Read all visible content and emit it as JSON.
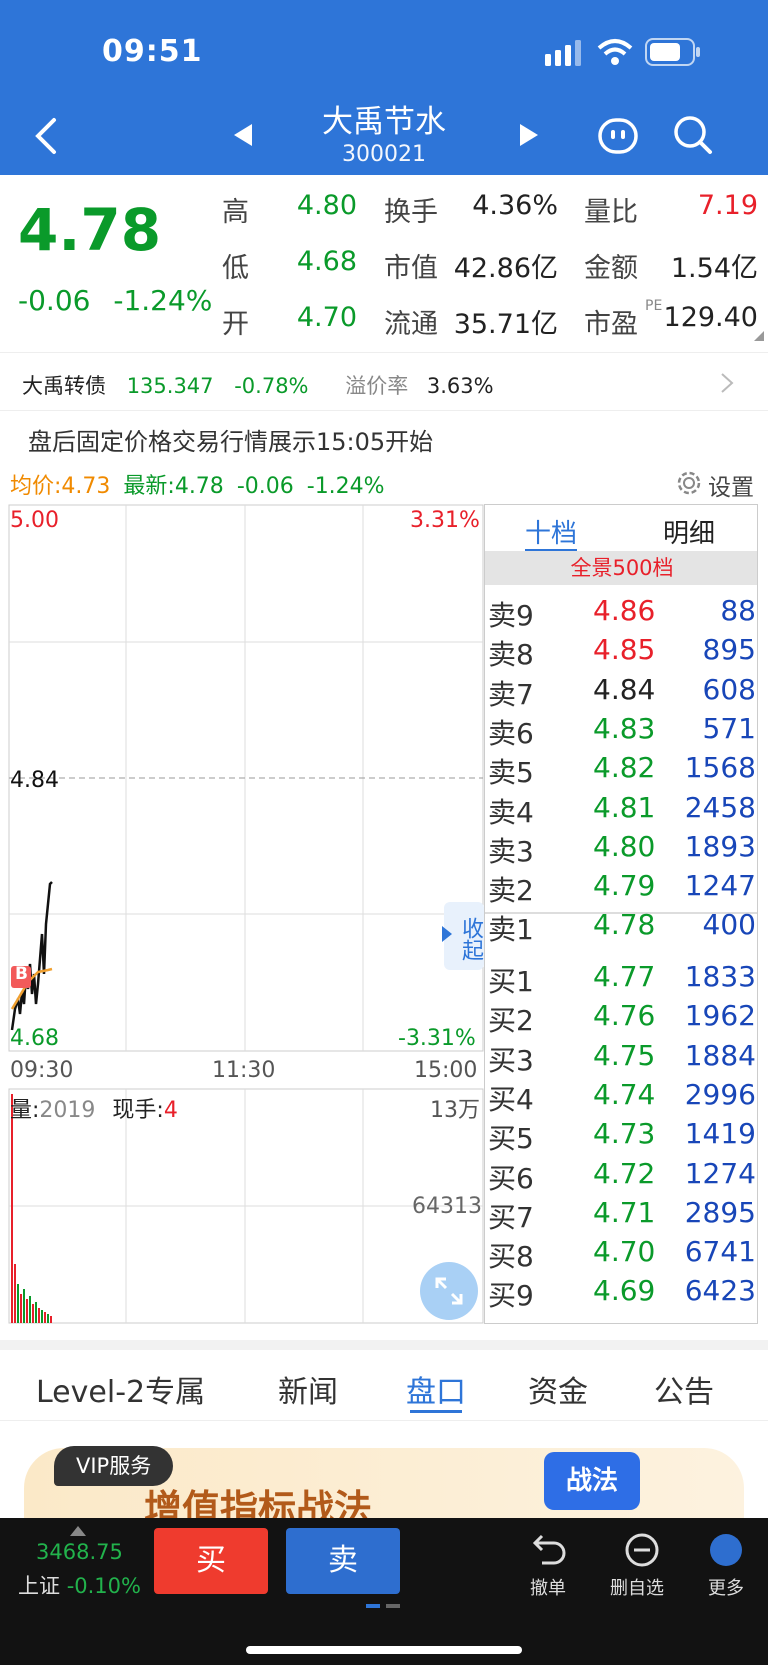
{
  "status_bar": {
    "time": "09:51"
  },
  "header": {
    "title": "大禹节水",
    "code": "300021"
  },
  "quote": {
    "price": "4.78",
    "change": "-0.06",
    "change_pct": "-1.24%",
    "fields": [
      {
        "label": "高",
        "value": "4.80",
        "color": "green"
      },
      {
        "label": "换手",
        "value": "4.36%",
        "color": "dark"
      },
      {
        "label": "量比",
        "value": "7.19",
        "color": "red"
      },
      {
        "label": "低",
        "value": "4.68",
        "color": "green"
      },
      {
        "label": "市值",
        "value": "42.86亿",
        "color": "dark"
      },
      {
        "label": "金额",
        "value": "1.54亿",
        "color": "dark"
      },
      {
        "label": "开",
        "value": "4.70",
        "color": "green"
      },
      {
        "label": "流通",
        "value": "35.71亿",
        "color": "dark"
      },
      {
        "label": "市盈",
        "value": "129.40",
        "color": "dark"
      }
    ],
    "pe_sup": "PE"
  },
  "bond": {
    "name": "大禹转债",
    "price": "135.347",
    "change": "-0.78%",
    "premium_label": "溢价率",
    "premium": "3.63%"
  },
  "notice": "盘后固定价格交易行情展示15:05开始",
  "chart_info": {
    "avg_label": "均价:4.73",
    "latest_label": "最新:4.78",
    "latest_change": "-0.06",
    "latest_pct": "-1.24%",
    "settings": "设置"
  },
  "chart": {
    "y_high": "5.00",
    "y_high_pct": "3.31%",
    "y_mid": "4.84",
    "y_low": "4.68",
    "y_low_pct": "-3.31%",
    "x_labels": [
      "09:30",
      "11:30",
      "15:00"
    ],
    "collapse": "收起",
    "b_marker": "B"
  },
  "volume": {
    "vol_label": "量:",
    "vol_value": "2019",
    "hand_label": "现手:",
    "hand_value": "4",
    "max": "13万",
    "mid": "64313"
  },
  "orderbook": {
    "tabs": [
      "十档",
      "明细"
    ],
    "banner": "全景500档",
    "asks": [
      {
        "label": "卖9",
        "price": "4.86",
        "vol": "88",
        "color": "red"
      },
      {
        "label": "卖8",
        "price": "4.85",
        "vol": "895",
        "color": "red"
      },
      {
        "label": "卖7",
        "price": "4.84",
        "vol": "608",
        "color": "dark"
      },
      {
        "label": "卖6",
        "price": "4.83",
        "vol": "571",
        "color": "green"
      },
      {
        "label": "卖5",
        "price": "4.82",
        "vol": "1568",
        "color": "green"
      },
      {
        "label": "卖4",
        "price": "4.81",
        "vol": "2458",
        "color": "green"
      },
      {
        "label": "卖3",
        "price": "4.80",
        "vol": "1893",
        "color": "green"
      },
      {
        "label": "卖2",
        "price": "4.79",
        "vol": "1247",
        "color": "green"
      },
      {
        "label": "卖1",
        "price": "4.78",
        "vol": "400",
        "color": "green"
      }
    ],
    "bids": [
      {
        "label": "买1",
        "price": "4.77",
        "vol": "1833",
        "color": "green"
      },
      {
        "label": "买2",
        "price": "4.76",
        "vol": "1962",
        "color": "green"
      },
      {
        "label": "买3",
        "price": "4.75",
        "vol": "1884",
        "color": "green"
      },
      {
        "label": "买4",
        "price": "4.74",
        "vol": "2996",
        "color": "green"
      },
      {
        "label": "买5",
        "price": "4.73",
        "vol": "1419",
        "color": "green"
      },
      {
        "label": "买6",
        "price": "4.72",
        "vol": "1274",
        "color": "green"
      },
      {
        "label": "买7",
        "price": "4.71",
        "vol": "2895",
        "color": "green"
      },
      {
        "label": "买8",
        "price": "4.70",
        "vol": "6741",
        "color": "green"
      },
      {
        "label": "买9",
        "price": "4.69",
        "vol": "6423",
        "color": "green"
      }
    ]
  },
  "tabs": [
    {
      "label": "Level-2专属"
    },
    {
      "label": "新闻"
    },
    {
      "label": "盘口"
    },
    {
      "label": "资金"
    },
    {
      "label": "公告"
    }
  ],
  "active_tab": "盘口",
  "banner": {
    "vip": "VIP服务",
    "title": "增值指标战法",
    "badge": "战法"
  },
  "bottom": {
    "index_value": "3468.75",
    "index_name": "上证",
    "index_pct": "-0.10%",
    "buy": "买",
    "sell": "卖",
    "actions": [
      {
        "label": "撤单",
        "icon": "undo-icon"
      },
      {
        "label": "删自选",
        "icon": "minus-circle-icon"
      },
      {
        "label": "更多",
        "icon": "more-icon"
      }
    ]
  },
  "colors": {
    "header": "#2e75d8",
    "green": "#0a9a2a",
    "red": "#e8202a",
    "blue": "#1846b8"
  }
}
